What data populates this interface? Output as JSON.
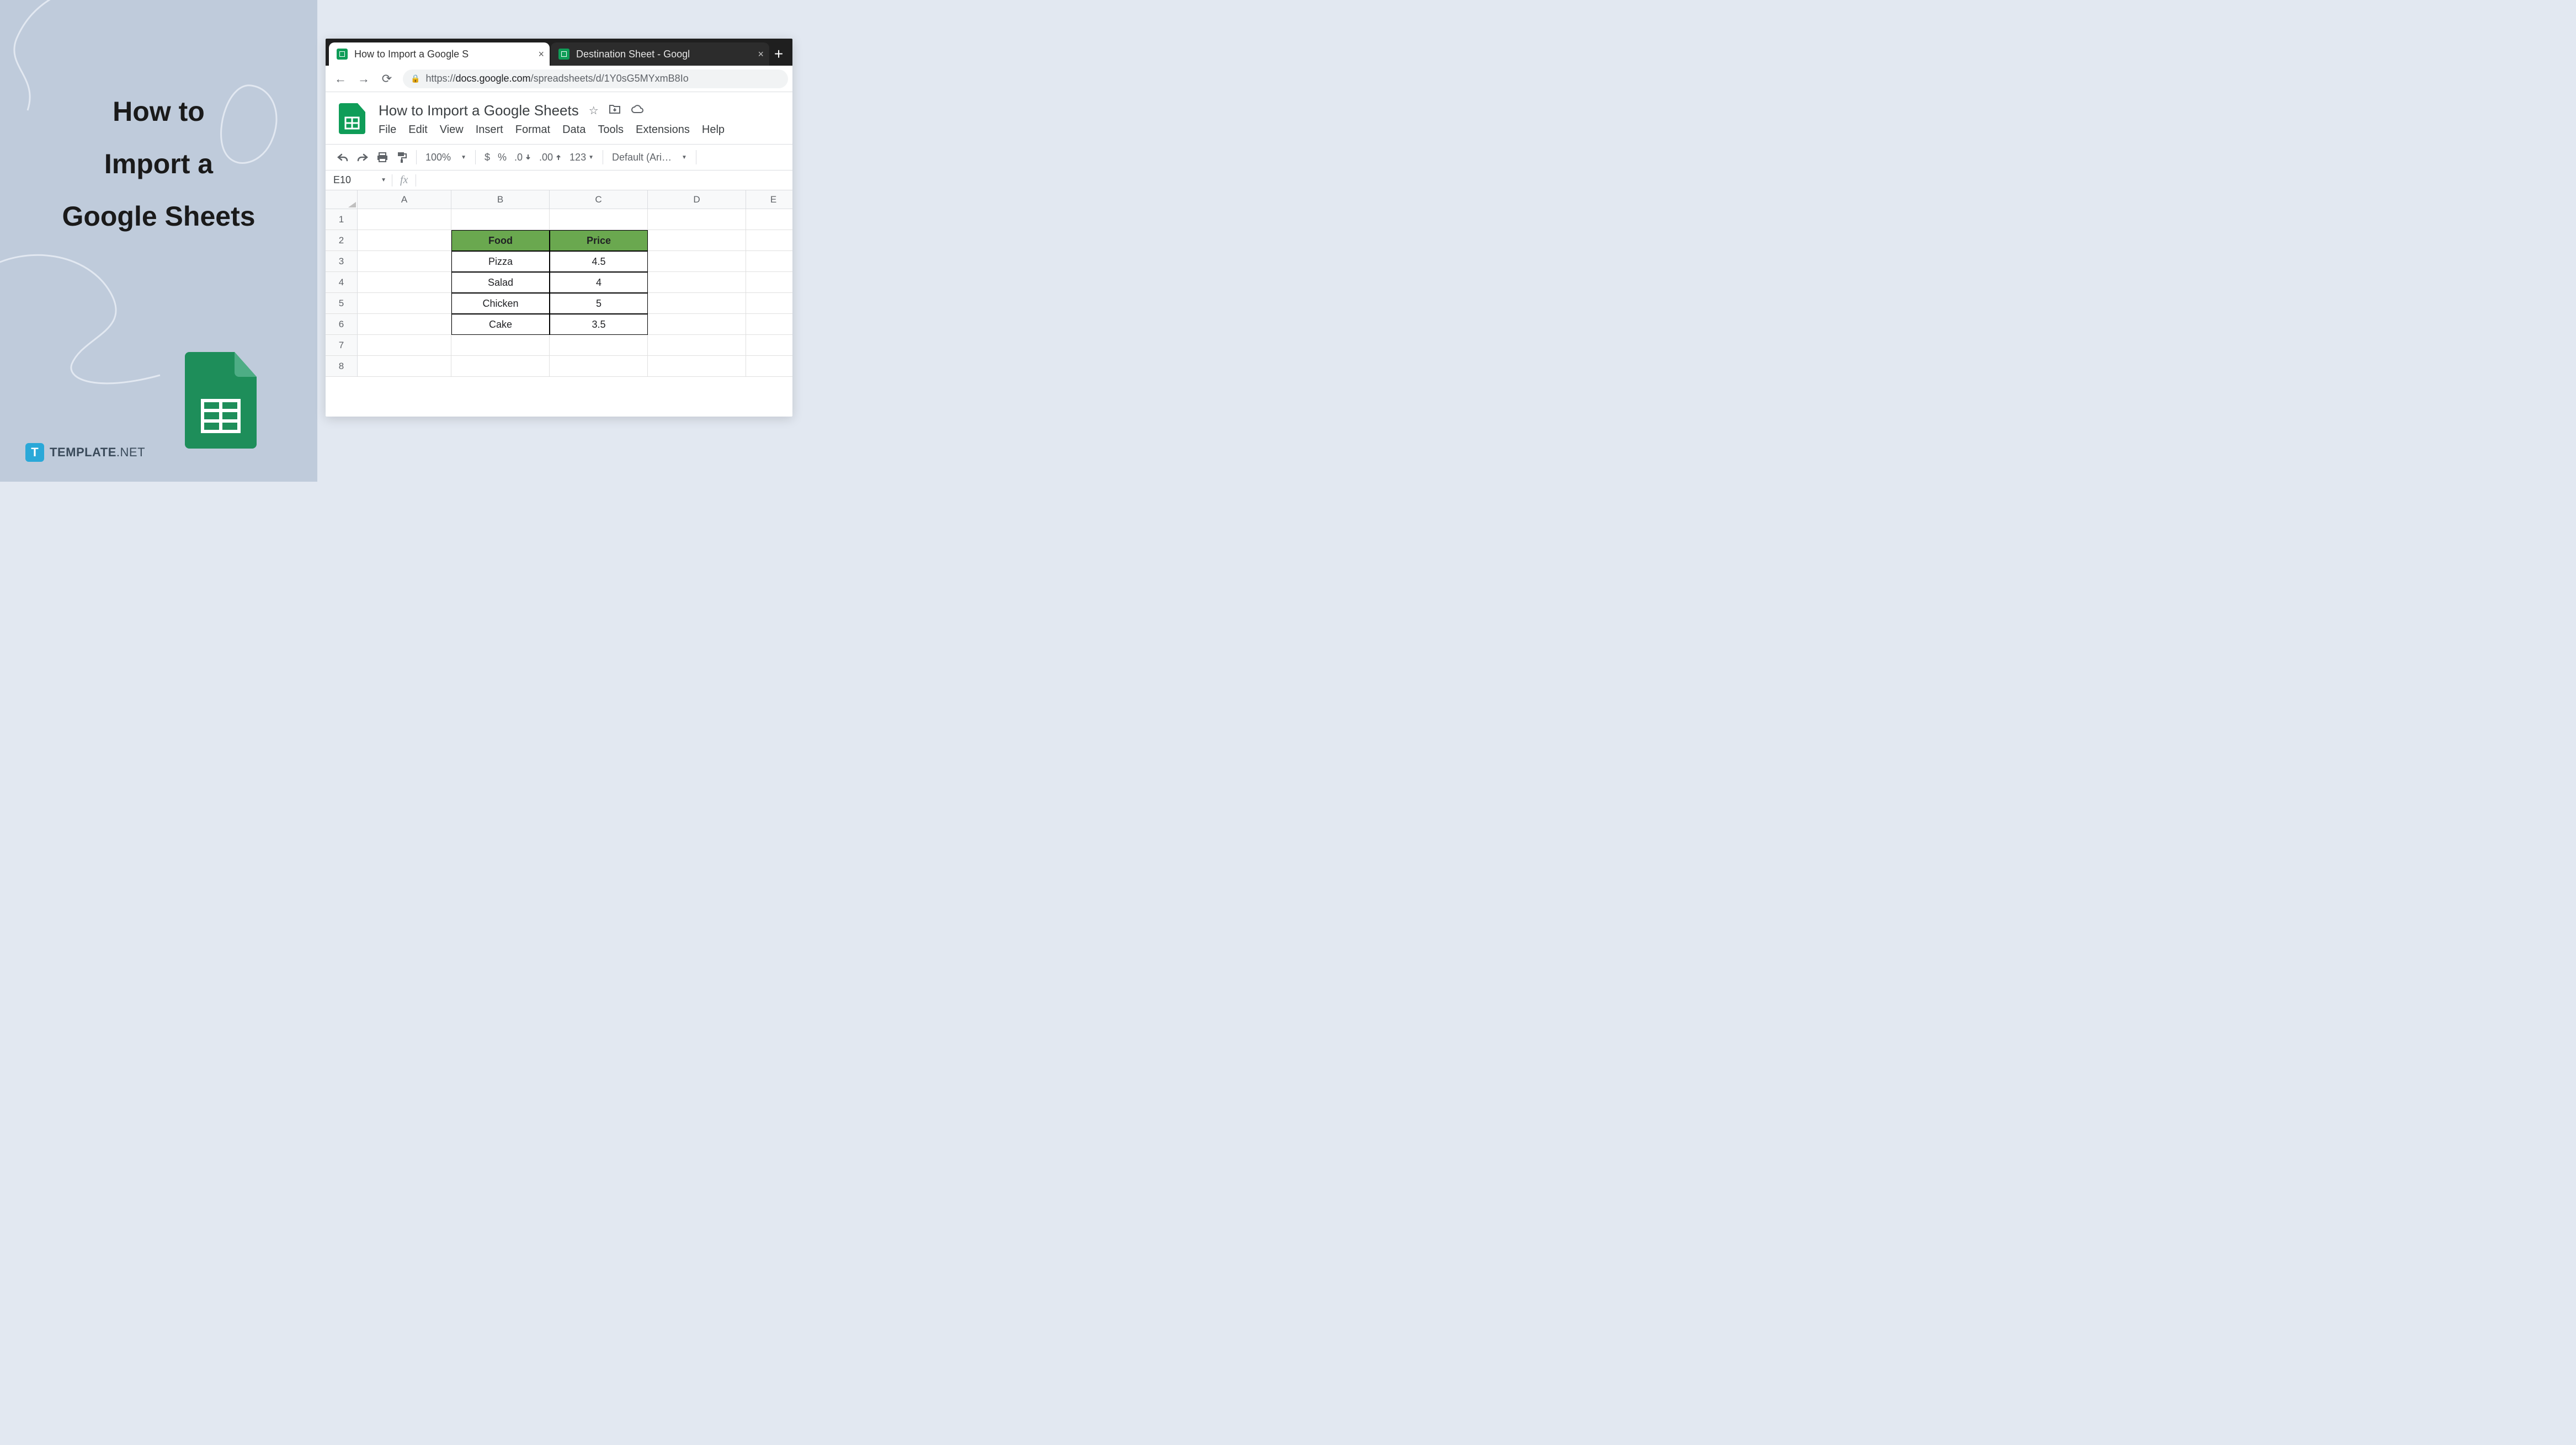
{
  "left": {
    "heading_l1": "How to",
    "heading_l2": "Import a",
    "heading_l3": "Google Sheets",
    "brand_main": "TEMPLATE",
    "brand_suffix": ".NET",
    "brand_icon_letter": "T"
  },
  "browser": {
    "tabs": [
      {
        "title": "How to Import a Google S",
        "active": true
      },
      {
        "title": "Destination Sheet - Googl",
        "active": false
      }
    ],
    "url_prefix": "https://",
    "url_host": "docs.google.com",
    "url_path": "/spreadsheets/d/1Y0sG5MYxmB8Io"
  },
  "doc": {
    "title": "How to Import a Google Sheets",
    "menu": [
      "File",
      "Edit",
      "View",
      "Insert",
      "Format",
      "Data",
      "Tools",
      "Extensions",
      "Help"
    ]
  },
  "toolbar": {
    "zoom": "100%",
    "currency": "$",
    "percent": "%",
    "dec_dec": ".0",
    "dec_inc": ".00",
    "num_fmt": "123",
    "font": "Default (Ari…"
  },
  "fx": {
    "namebox": "E10",
    "label": "fx"
  },
  "grid": {
    "columns": [
      "A",
      "B",
      "C",
      "D",
      "E"
    ],
    "rows": [
      "1",
      "2",
      "3",
      "4",
      "5",
      "6",
      "7",
      "8"
    ],
    "table": {
      "headers": [
        "Food",
        "Price"
      ],
      "data": [
        [
          "Pizza",
          "4.5"
        ],
        [
          "Salad",
          "4"
        ],
        [
          "Chicken",
          "5"
        ],
        [
          "Cake",
          "3.5"
        ]
      ]
    }
  }
}
